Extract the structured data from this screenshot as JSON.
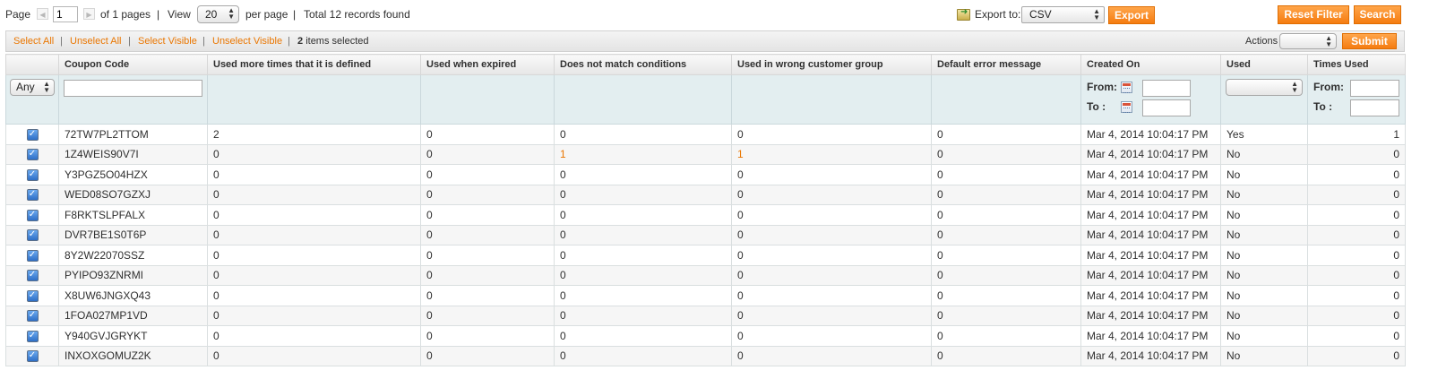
{
  "pager": {
    "page_label": "Page",
    "page_value": "1",
    "of_pages": "of 1 pages",
    "separator": "|",
    "view_label": "View",
    "view_value": "20",
    "per_page": "per page",
    "total": "Total 12 records found"
  },
  "export": {
    "label": "Export to:",
    "format": "CSV",
    "button": "Export"
  },
  "actions_top": {
    "reset_filter": "Reset Filter",
    "search": "Search"
  },
  "massaction": {
    "select_all": "Select All",
    "unselect_all": "Unselect All",
    "select_visible": "Select Visible",
    "unselect_visible": "Unselect Visible",
    "separator": "|",
    "selected_count": "2",
    "selected_text": "items selected",
    "actions_label": "Actions",
    "actions_value": "",
    "submit": "Submit"
  },
  "columns": [
    "Coupon Code",
    "Used more times that it is defined",
    "Used when expired",
    "Does not match conditions",
    "Used in wrong customer group",
    "Default error message",
    "Created On",
    "Used",
    "Times Used"
  ],
  "filters": {
    "massaction_value": "Any",
    "coupon_code_value": "",
    "from_label": "From:",
    "to_label": "To :",
    "used_value": ""
  },
  "colors": {
    "accent": "#ea7601",
    "button": "#f57c10",
    "filter_bg": "#e3eef0"
  },
  "rows": [
    {
      "code": "72TW7PL2TTOM",
      "used_more": "2",
      "expired": "0",
      "conditions": "0",
      "wrong_group": "0",
      "default_error": "0",
      "created": "Mar 4, 2014 10:04:17 PM",
      "used": "Yes",
      "times": "1"
    },
    {
      "code": "1Z4WEIS90V7I",
      "used_more": "0",
      "expired": "0",
      "conditions": "1",
      "wrong_group": "1",
      "default_error": "0",
      "created": "Mar 4, 2014 10:04:17 PM",
      "used": "No",
      "times": "0"
    },
    {
      "code": "Y3PGZ5O04HZX",
      "used_more": "0",
      "expired": "0",
      "conditions": "0",
      "wrong_group": "0",
      "default_error": "0",
      "created": "Mar 4, 2014 10:04:17 PM",
      "used": "No",
      "times": "0"
    },
    {
      "code": "WED08SO7GZXJ",
      "used_more": "0",
      "expired": "0",
      "conditions": "0",
      "wrong_group": "0",
      "default_error": "0",
      "created": "Mar 4, 2014 10:04:17 PM",
      "used": "No",
      "times": "0"
    },
    {
      "code": "F8RKTSLPFALX",
      "used_more": "0",
      "expired": "0",
      "conditions": "0",
      "wrong_group": "0",
      "default_error": "0",
      "created": "Mar 4, 2014 10:04:17 PM",
      "used": "No",
      "times": "0"
    },
    {
      "code": "DVR7BE1S0T6P",
      "used_more": "0",
      "expired": "0",
      "conditions": "0",
      "wrong_group": "0",
      "default_error": "0",
      "created": "Mar 4, 2014 10:04:17 PM",
      "used": "No",
      "times": "0"
    },
    {
      "code": "8Y2W22070SSZ",
      "used_more": "0",
      "expired": "0",
      "conditions": "0",
      "wrong_group": "0",
      "default_error": "0",
      "created": "Mar 4, 2014 10:04:17 PM",
      "used": "No",
      "times": "0"
    },
    {
      "code": "PYIPO93ZNRMI",
      "used_more": "0",
      "expired": "0",
      "conditions": "0",
      "wrong_group": "0",
      "default_error": "0",
      "created": "Mar 4, 2014 10:04:17 PM",
      "used": "No",
      "times": "0"
    },
    {
      "code": "X8UW6JNGXQ43",
      "used_more": "0",
      "expired": "0",
      "conditions": "0",
      "wrong_group": "0",
      "default_error": "0",
      "created": "Mar 4, 2014 10:04:17 PM",
      "used": "No",
      "times": "0"
    },
    {
      "code": "1FOA027MP1VD",
      "used_more": "0",
      "expired": "0",
      "conditions": "0",
      "wrong_group": "0",
      "default_error": "0",
      "created": "Mar 4, 2014 10:04:17 PM",
      "used": "No",
      "times": "0"
    },
    {
      "code": "Y940GVJGRYKT",
      "used_more": "0",
      "expired": "0",
      "conditions": "0",
      "wrong_group": "0",
      "default_error": "0",
      "created": "Mar 4, 2014 10:04:17 PM",
      "used": "No",
      "times": "0"
    },
    {
      "code": "INXOXGOMUZ2K",
      "used_more": "0",
      "expired": "0",
      "conditions": "0",
      "wrong_group": "0",
      "default_error": "0",
      "created": "Mar 4, 2014 10:04:17 PM",
      "used": "No",
      "times": "0"
    }
  ]
}
